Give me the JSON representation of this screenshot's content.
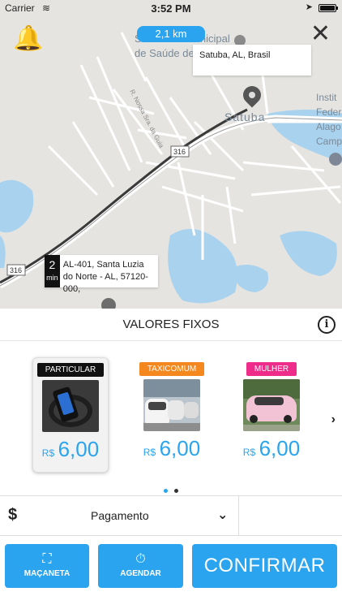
{
  "status_bar": {
    "carrier": "Carrier",
    "time": "3:52 PM"
  },
  "map": {
    "distance": "2,1 km",
    "destination": "Satuba, AL, Brasil",
    "origin_eta_value": "2",
    "origin_eta_unit": "min",
    "origin_address": "AL-401, Santa Luzia do Norte - AL, 57120-000,",
    "labels": {
      "secretaria": "Secretaria Municipal",
      "saude": "de Saúde de",
      "satuba": "Satuba",
      "street_nossa": "R. Nossa Sra. da Guia",
      "road_316a": "316",
      "road_316b": "316",
      "instituto_1": "Instit",
      "instituto_2": "Federa",
      "instituto_3": "Alago",
      "instituto_4": "Camp"
    }
  },
  "panel": {
    "title": "VALORES FIXOS",
    "categories": [
      {
        "tag": "PARTICULAR",
        "currency": "R$",
        "price": "6,00",
        "tag_color": "#111111",
        "selected": true
      },
      {
        "tag": "TAXICOMUM",
        "currency": "R$",
        "price": "6,00",
        "tag_color": "#f5871f",
        "selected": false
      },
      {
        "tag": "MULHER",
        "currency": "R$",
        "price": "6,00",
        "tag_color": "#ee2d8b",
        "selected": false
      }
    ],
    "payment_label": "Pagamento"
  },
  "actions": {
    "handle_label": "MAÇANETA",
    "schedule_label": "AGENDAR",
    "confirm_label": "CONFIRMAR"
  },
  "colors": {
    "accent": "#2aa4ee",
    "map_bg": "#e6e4e0",
    "water": "#a9d2ee"
  }
}
